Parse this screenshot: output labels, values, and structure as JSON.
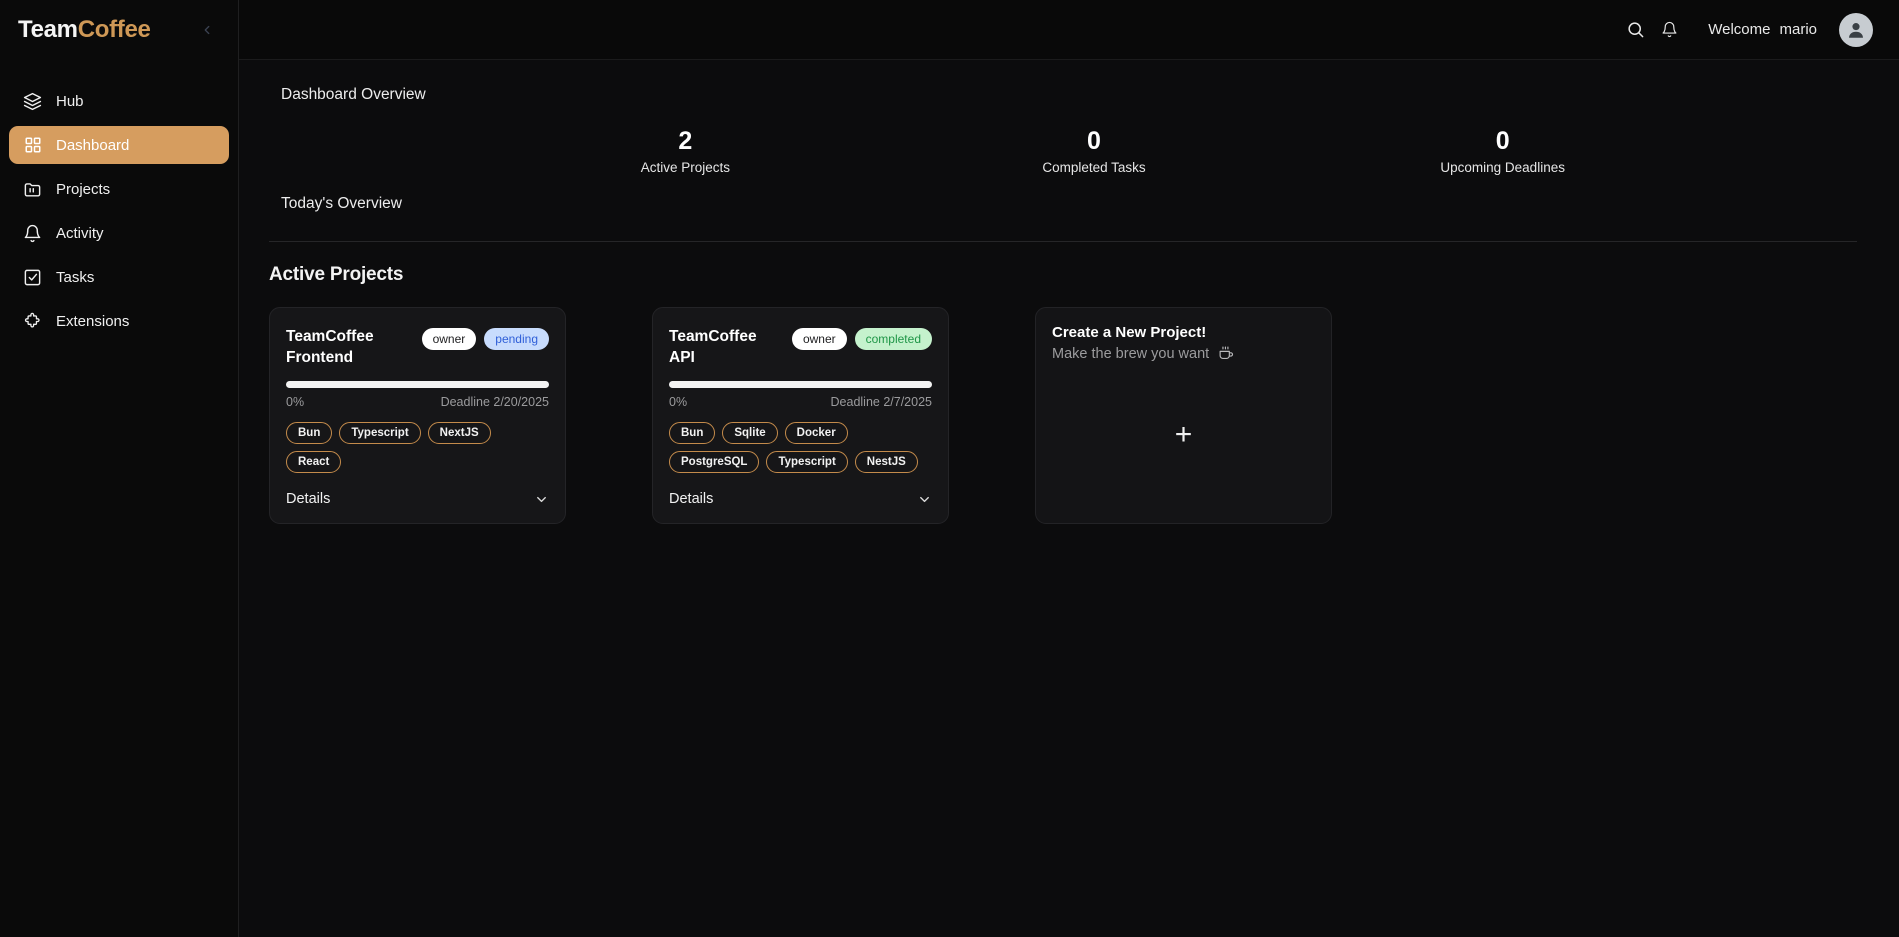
{
  "sidebar": {
    "logo": {
      "part1": "Team",
      "part2": "Coffee"
    },
    "collapse_icon": "chevron-left-icon",
    "items": [
      {
        "label": "Hub",
        "icon": "layers-icon",
        "active": false
      },
      {
        "label": "Dashboard",
        "icon": "grid-icon",
        "active": true
      },
      {
        "label": "Projects",
        "icon": "folder-icon",
        "active": false
      },
      {
        "label": "Activity",
        "icon": "bell-icon",
        "active": false
      },
      {
        "label": "Tasks",
        "icon": "check-square-icon",
        "active": false
      },
      {
        "label": "Extensions",
        "icon": "puzzle-icon",
        "active": false
      }
    ]
  },
  "topbar": {
    "search_icon": "search-icon",
    "notification_icon": "bell-icon",
    "welcome_text": "Welcome",
    "username": "mario",
    "avatar_icon": "user-avatar-icon"
  },
  "overview": {
    "title": "Dashboard Overview",
    "today_title": "Today's Overview",
    "stats": [
      {
        "value": "2",
        "label": "Active Projects"
      },
      {
        "value": "0",
        "label": "Completed Tasks"
      },
      {
        "value": "0",
        "label": "Upcoming Deadlines"
      }
    ]
  },
  "projects": {
    "section_title": "Active Projects",
    "details_label": "Details",
    "chevron_icon": "chevron-down-icon",
    "items": [
      {
        "title": "TeamCoffee Frontend",
        "role_badge": "owner",
        "status_badge": "pending",
        "status_kind": "pending",
        "progress_pct": "0%",
        "progress_value": 0,
        "deadline": "Deadline 2/20/2025",
        "tags": [
          "Bun",
          "Typescript",
          "NextJS",
          "React"
        ]
      },
      {
        "title": "TeamCoffee API",
        "role_badge": "owner",
        "status_badge": "completed",
        "status_kind": "completed",
        "progress_pct": "0%",
        "progress_value": 0,
        "deadline": "Deadline 2/7/2025",
        "tags": [
          "Bun",
          "Sqlite",
          "Docker",
          "PostgreSQL",
          "Typescript",
          "NestJS"
        ]
      }
    ],
    "new_card": {
      "title": "Create a New Project!",
      "subtitle": "Make the brew you want",
      "cup_icon": "coffee-cup-icon",
      "plus_icon": "plus-icon",
      "plus_glyph": "+"
    }
  },
  "colors": {
    "accent": "#d69d5f",
    "logo_accent": "#cf9856",
    "tag_border": "#c48b4b",
    "badge_pending_bg": "#c8dcfd",
    "badge_pending_fg": "#2f5fd8",
    "badge_completed_bg": "#c5f2cd",
    "badge_completed_fg": "#1f9647",
    "background": "#0a0a0a",
    "card_background": "#161618"
  }
}
